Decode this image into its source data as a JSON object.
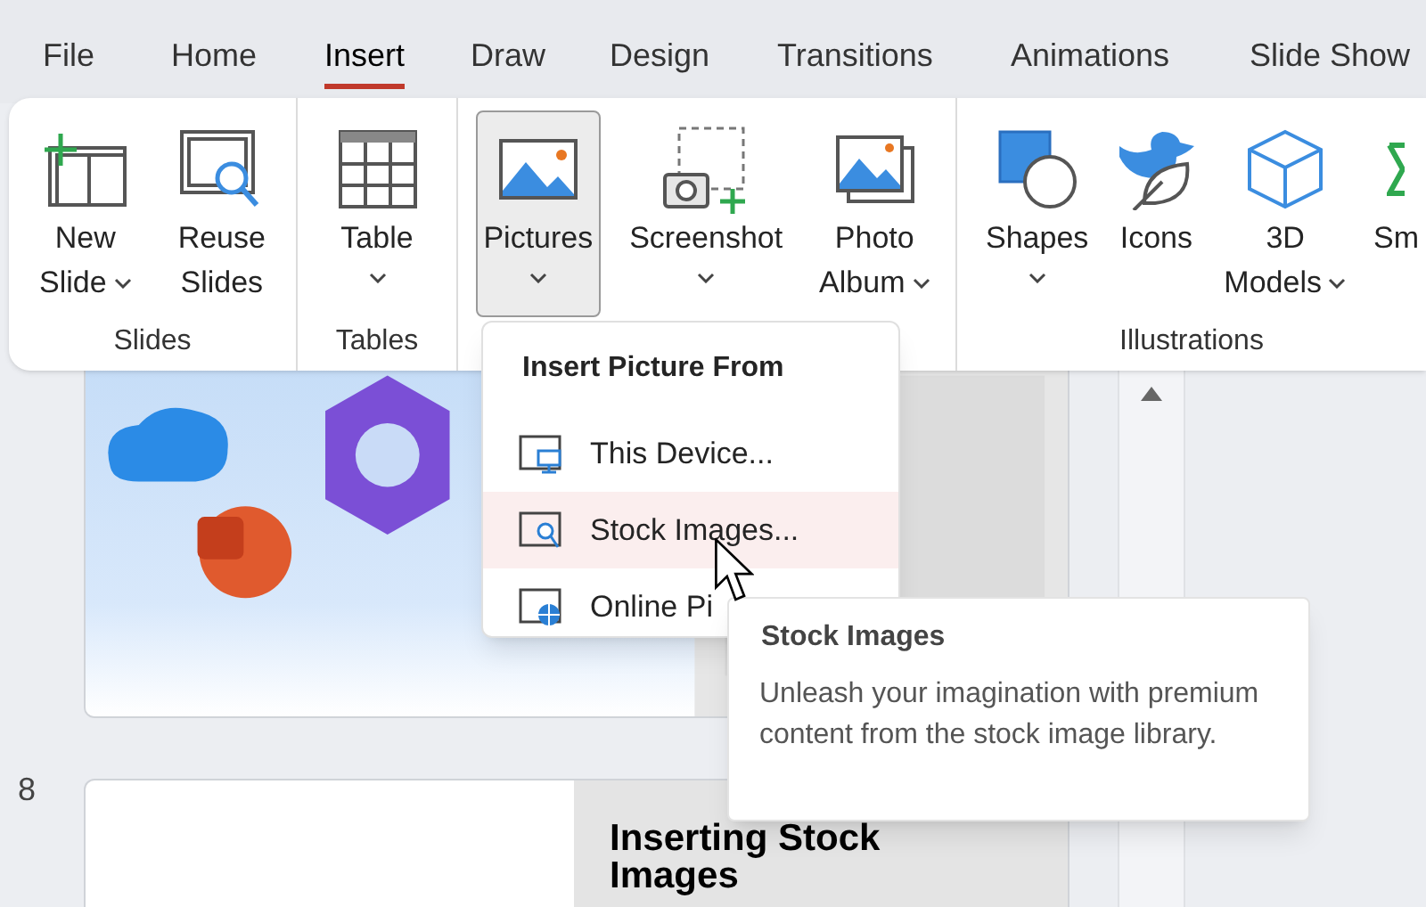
{
  "tabs": [
    {
      "label": "File",
      "selected": false
    },
    {
      "label": "Home",
      "selected": false
    },
    {
      "label": "Insert",
      "selected": true
    },
    {
      "label": "Draw",
      "selected": false
    },
    {
      "label": "Design",
      "selected": false
    },
    {
      "label": "Transitions",
      "selected": false
    },
    {
      "label": "Animations",
      "selected": false
    },
    {
      "label": "Slide Show",
      "selected": false
    }
  ],
  "ribbon": {
    "groups": [
      {
        "label": "Slides",
        "buttons": [
          {
            "lines": [
              "New",
              "Slide"
            ],
            "dropdown": true,
            "pressed": false
          },
          {
            "lines": [
              "Reuse",
              "Slides"
            ],
            "dropdown": false,
            "pressed": false
          }
        ]
      },
      {
        "label": "Tables",
        "buttons": [
          {
            "lines": [
              "Table"
            ],
            "dropdown": true,
            "pressed": false
          }
        ]
      },
      {
        "buttons": [
          {
            "lines": [
              "Pictures"
            ],
            "dropdown": true,
            "pressed": true
          },
          {
            "lines": [
              "Screenshot"
            ],
            "dropdown": true,
            "pressed": false
          },
          {
            "lines": [
              "Photo",
              "Album"
            ],
            "dropdown": true,
            "pressed": false
          }
        ]
      },
      {
        "label": "Illustrations",
        "buttons": [
          {
            "lines": [
              "Shapes"
            ],
            "dropdown": true,
            "pressed": false
          },
          {
            "lines": [
              "Icons"
            ],
            "dropdown": false,
            "pressed": false
          },
          {
            "lines": [
              "3D",
              "Models"
            ],
            "dropdown": true,
            "pressed": false
          },
          {
            "lines": [
              "Sm"
            ],
            "dropdown": false,
            "pressed": false
          }
        ]
      }
    ]
  },
  "picture_menu": {
    "title": "Insert Picture From",
    "items": [
      {
        "label": "This Device...",
        "selected": false
      },
      {
        "label": "Stock Images...",
        "selected": true
      },
      {
        "label": "Online Pi",
        "selected": false
      }
    ]
  },
  "tooltip": {
    "title": "Stock Images",
    "text": "Unleash your imagination with premium content from the stock image library."
  },
  "slides": [
    {
      "number": "8",
      "heading": "Inserting Stock Images"
    }
  ]
}
